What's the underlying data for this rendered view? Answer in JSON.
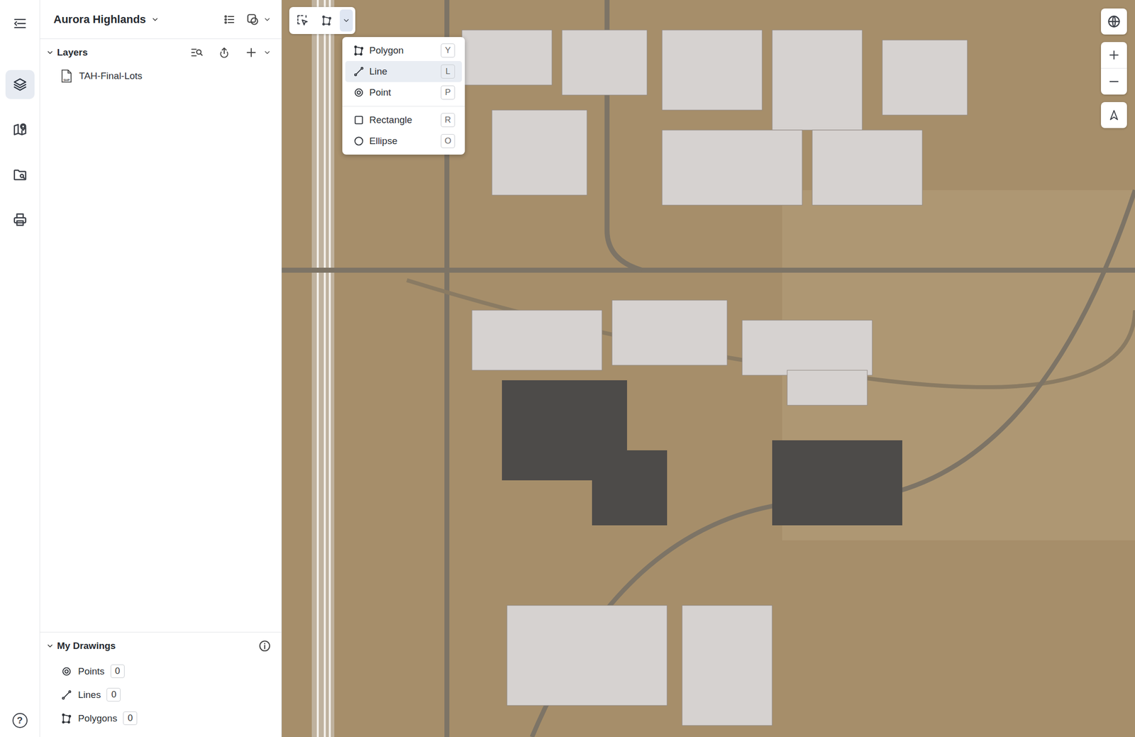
{
  "project": {
    "title": "Aurora Highlands"
  },
  "rail": {
    "items": [
      {
        "selected": true
      },
      {
        "selected": false
      },
      {
        "selected": false
      },
      {
        "selected": false
      }
    ],
    "help": "?"
  },
  "layers": {
    "title": "Layers",
    "expanded": true,
    "items": [
      {
        "label": "TAH-Final-Lots",
        "badge": "SHP"
      }
    ]
  },
  "drawings": {
    "title": "My Drawings",
    "expanded": true,
    "items": [
      {
        "label": "Points",
        "count": "0"
      },
      {
        "label": "Lines",
        "count": "0"
      },
      {
        "label": "Polygons",
        "count": "0"
      }
    ]
  },
  "toolbar": {
    "dropdown_open": true
  },
  "draw_menu": {
    "groups": [
      [
        {
          "label": "Polygon",
          "key": "Y",
          "hovered": false
        },
        {
          "label": "Line",
          "key": "L",
          "hovered": true
        },
        {
          "label": "Point",
          "key": "P",
          "hovered": false
        }
      ],
      [
        {
          "label": "Rectangle",
          "key": "R",
          "hovered": false
        },
        {
          "label": "Ellipse",
          "key": "O",
          "hovered": false
        }
      ]
    ]
  }
}
